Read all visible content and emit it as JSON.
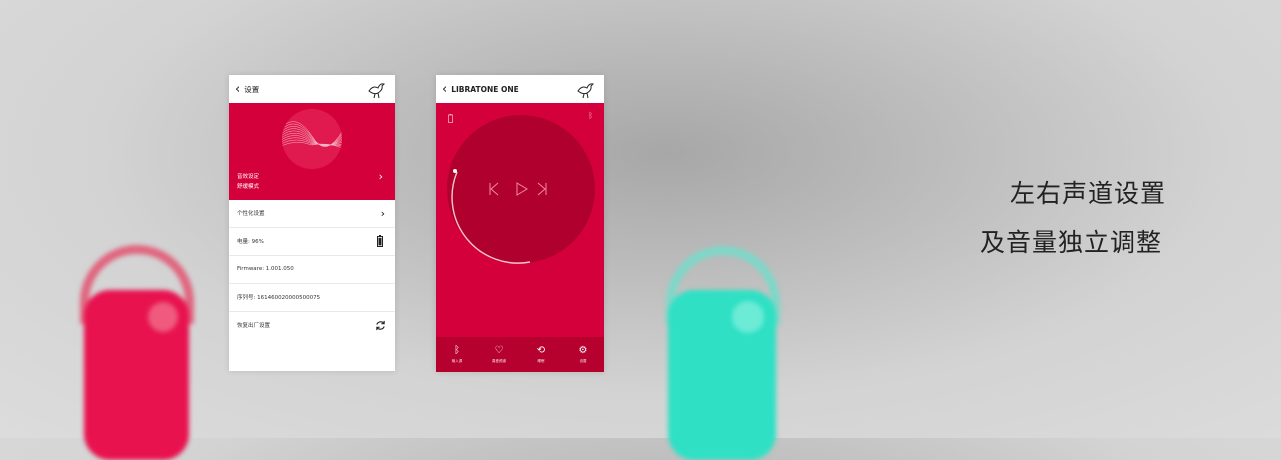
{
  "settings_screen": {
    "title": "设置",
    "profile": {
      "line1": "音效设定",
      "line2": "舒缓模式"
    },
    "rows": [
      {
        "label": "个性化设置"
      },
      {
        "label": "电量: 96%"
      },
      {
        "label": "Firmware: 1.001.050"
      },
      {
        "label": "序列号: 161460020000500075"
      },
      {
        "label": "恢复出厂设置"
      }
    ]
  },
  "player_screen": {
    "title": "LIBRATONE ONE",
    "volume": 0.36,
    "tabs": [
      {
        "icon": "bluetooth-icon",
        "label": "输入源"
      },
      {
        "icon": "heart-icon",
        "label": "喜爱频道"
      },
      {
        "icon": "timer-icon",
        "label": "睡眠"
      },
      {
        "icon": "gear-icon",
        "label": "设置"
      }
    ]
  },
  "caption": {
    "line1": "左右声道设置",
    "line2": "及音量独立调整"
  },
  "colors": {
    "accent_red": "#d4003b",
    "dark_red": "#b6002e",
    "teal": "#2fe0c4",
    "pink_speaker": "#e8124f"
  }
}
